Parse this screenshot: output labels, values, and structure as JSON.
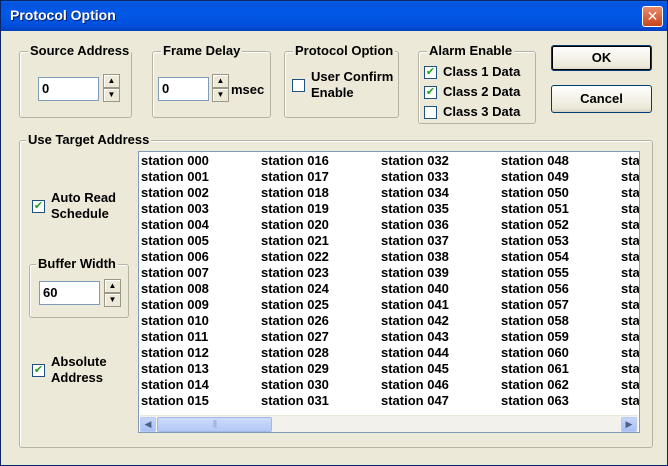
{
  "window": {
    "title": "Protocol Option",
    "close_glyph": "✕"
  },
  "source_address": {
    "title": "Source Address",
    "value": "0"
  },
  "frame_delay": {
    "title": "Frame Delay",
    "value": "0",
    "unit": "msec"
  },
  "protocol_option": {
    "title": "Protocol Option",
    "user_confirm": {
      "label_line1": "User Confirm",
      "label_line2": "Enable",
      "checked": false
    }
  },
  "alarm_enable": {
    "title": "Alarm Enable",
    "class1": {
      "label": "Class 1 Data",
      "checked": true
    },
    "class2": {
      "label": "Class 2 Data",
      "checked": true
    },
    "class3": {
      "label": "Class 3 Data",
      "checked": false
    }
  },
  "buttons": {
    "ok": "OK",
    "cancel": "Cancel"
  },
  "target": {
    "title": "Use Target Address",
    "auto_read": {
      "label_line1": "Auto Read",
      "label_line2": "Schedule",
      "checked": true
    },
    "buffer_width": {
      "title": "Buffer Width",
      "value": "60"
    },
    "absolute": {
      "label_line1": "Absolute",
      "label_line2": "Address",
      "checked": true
    }
  },
  "station_list": {
    "columns": [
      [
        "station 000",
        "station 001",
        "station 002",
        "station 003",
        "station 004",
        "station 005",
        "station 006",
        "station 007",
        "station 008",
        "station 009",
        "station 010",
        "station 011",
        "station 012",
        "station 013",
        "station 014",
        "station 015"
      ],
      [
        "station 016",
        "station 017",
        "station 018",
        "station 019",
        "station 020",
        "station 021",
        "station 022",
        "station 023",
        "station 024",
        "station 025",
        "station 026",
        "station 027",
        "station 028",
        "station 029",
        "station 030",
        "station 031"
      ],
      [
        "station 032",
        "station 033",
        "station 034",
        "station 035",
        "station 036",
        "station 037",
        "station 038",
        "station 039",
        "station 040",
        "station 041",
        "station 042",
        "station 043",
        "station 044",
        "station 045",
        "station 046",
        "station 047"
      ],
      [
        "station 048",
        "station 049",
        "station 050",
        "station 051",
        "station 052",
        "station 053",
        "station 054",
        "station 055",
        "station 056",
        "station 057",
        "station 058",
        "station 059",
        "station 060",
        "station 061",
        "station 062",
        "station 063"
      ],
      [
        "sta",
        "sta",
        "sta",
        "sta",
        "sta",
        "sta",
        "sta",
        "sta",
        "sta",
        "sta",
        "sta",
        "sta",
        "sta",
        "sta",
        "sta",
        "sta"
      ]
    ]
  },
  "check_glyph": "✔",
  "icons": {
    "spin_up": "▲",
    "spin_down": "▼",
    "scroll_left": "◀",
    "scroll_right": "▶",
    "thumb_grip": "|||"
  }
}
